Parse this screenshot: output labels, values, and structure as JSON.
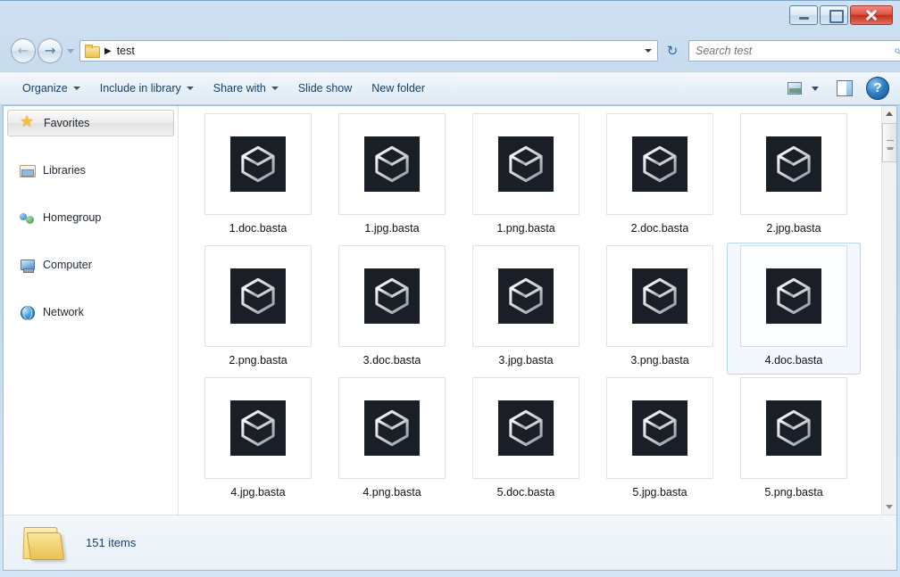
{
  "window": {
    "title": "test",
    "controls": {
      "minimize": "minimize",
      "maximize": "maximize",
      "close": "close"
    }
  },
  "navigation": {
    "back_label": "←",
    "forward_label": "→",
    "breadcrumb_separator": "▶",
    "breadcrumb_text": "test",
    "refresh_label": "↻",
    "folder_icon": "folder-icon",
    "history_dropdown_icon": "chevron-down-icon",
    "address_dropdown_icon": "chevron-down-icon"
  },
  "search": {
    "placeholder": "Search test",
    "icon": "search-icon",
    "icon_glyph": "⌕"
  },
  "toolbar": {
    "items": [
      {
        "label": "Organize",
        "has_caret": true
      },
      {
        "label": "Include in library",
        "has_caret": true
      },
      {
        "label": "Share with",
        "has_caret": true
      },
      {
        "label": "Slide show",
        "has_caret": false
      },
      {
        "label": "New folder",
        "has_caret": false
      }
    ],
    "views_icon": "change-view-icon",
    "views_dropdown_icon": "chevron-down-icon",
    "preview_pane_icon": "preview-pane-icon",
    "help_label": "?",
    "help_icon": "help-icon"
  },
  "sidebar": {
    "items": [
      {
        "label": "Favorites",
        "icon": "star-icon",
        "icon_class": "star",
        "selected": true
      },
      {
        "label": "Libraries",
        "icon": "library-icon",
        "icon_class": "library",
        "selected": false
      },
      {
        "label": "Homegroup",
        "icon": "homegroup-icon",
        "icon_class": "homegroup",
        "selected": false
      },
      {
        "label": "Computer",
        "icon": "computer-icon",
        "icon_class": "computer",
        "selected": false
      },
      {
        "label": "Network",
        "icon": "network-icon",
        "icon_class": "network",
        "selected": false
      }
    ]
  },
  "files": {
    "icon_name": "basta-cube-icon",
    "icon_background": "#191e27",
    "icon_color": "#c8ccd2",
    "selection_border": "#b4d5ee",
    "selection_background": "#f2f8fd",
    "items": [
      {
        "name": "1.doc.basta",
        "selected": false
      },
      {
        "name": "1.jpg.basta",
        "selected": false
      },
      {
        "name": "1.png.basta",
        "selected": false
      },
      {
        "name": "2.doc.basta",
        "selected": false
      },
      {
        "name": "2.jpg.basta",
        "selected": false
      },
      {
        "name": "2.png.basta",
        "selected": false
      },
      {
        "name": "3.doc.basta",
        "selected": false
      },
      {
        "name": "3.jpg.basta",
        "selected": false
      },
      {
        "name": "3.png.basta",
        "selected": false
      },
      {
        "name": "4.doc.basta",
        "selected": true
      },
      {
        "name": "4.jpg.basta",
        "selected": false
      },
      {
        "name": "4.png.basta",
        "selected": false
      },
      {
        "name": "5.doc.basta",
        "selected": false
      },
      {
        "name": "5.jpg.basta",
        "selected": false
      },
      {
        "name": "5.png.basta",
        "selected": false
      }
    ]
  },
  "scrollbar": {
    "up_arrow": "scroll-up-arrow",
    "down_arrow": "scroll-down-arrow",
    "thumb": "scroll-thumb"
  },
  "status": {
    "text": "151 items",
    "folder_icon": "open-folder-icon"
  }
}
